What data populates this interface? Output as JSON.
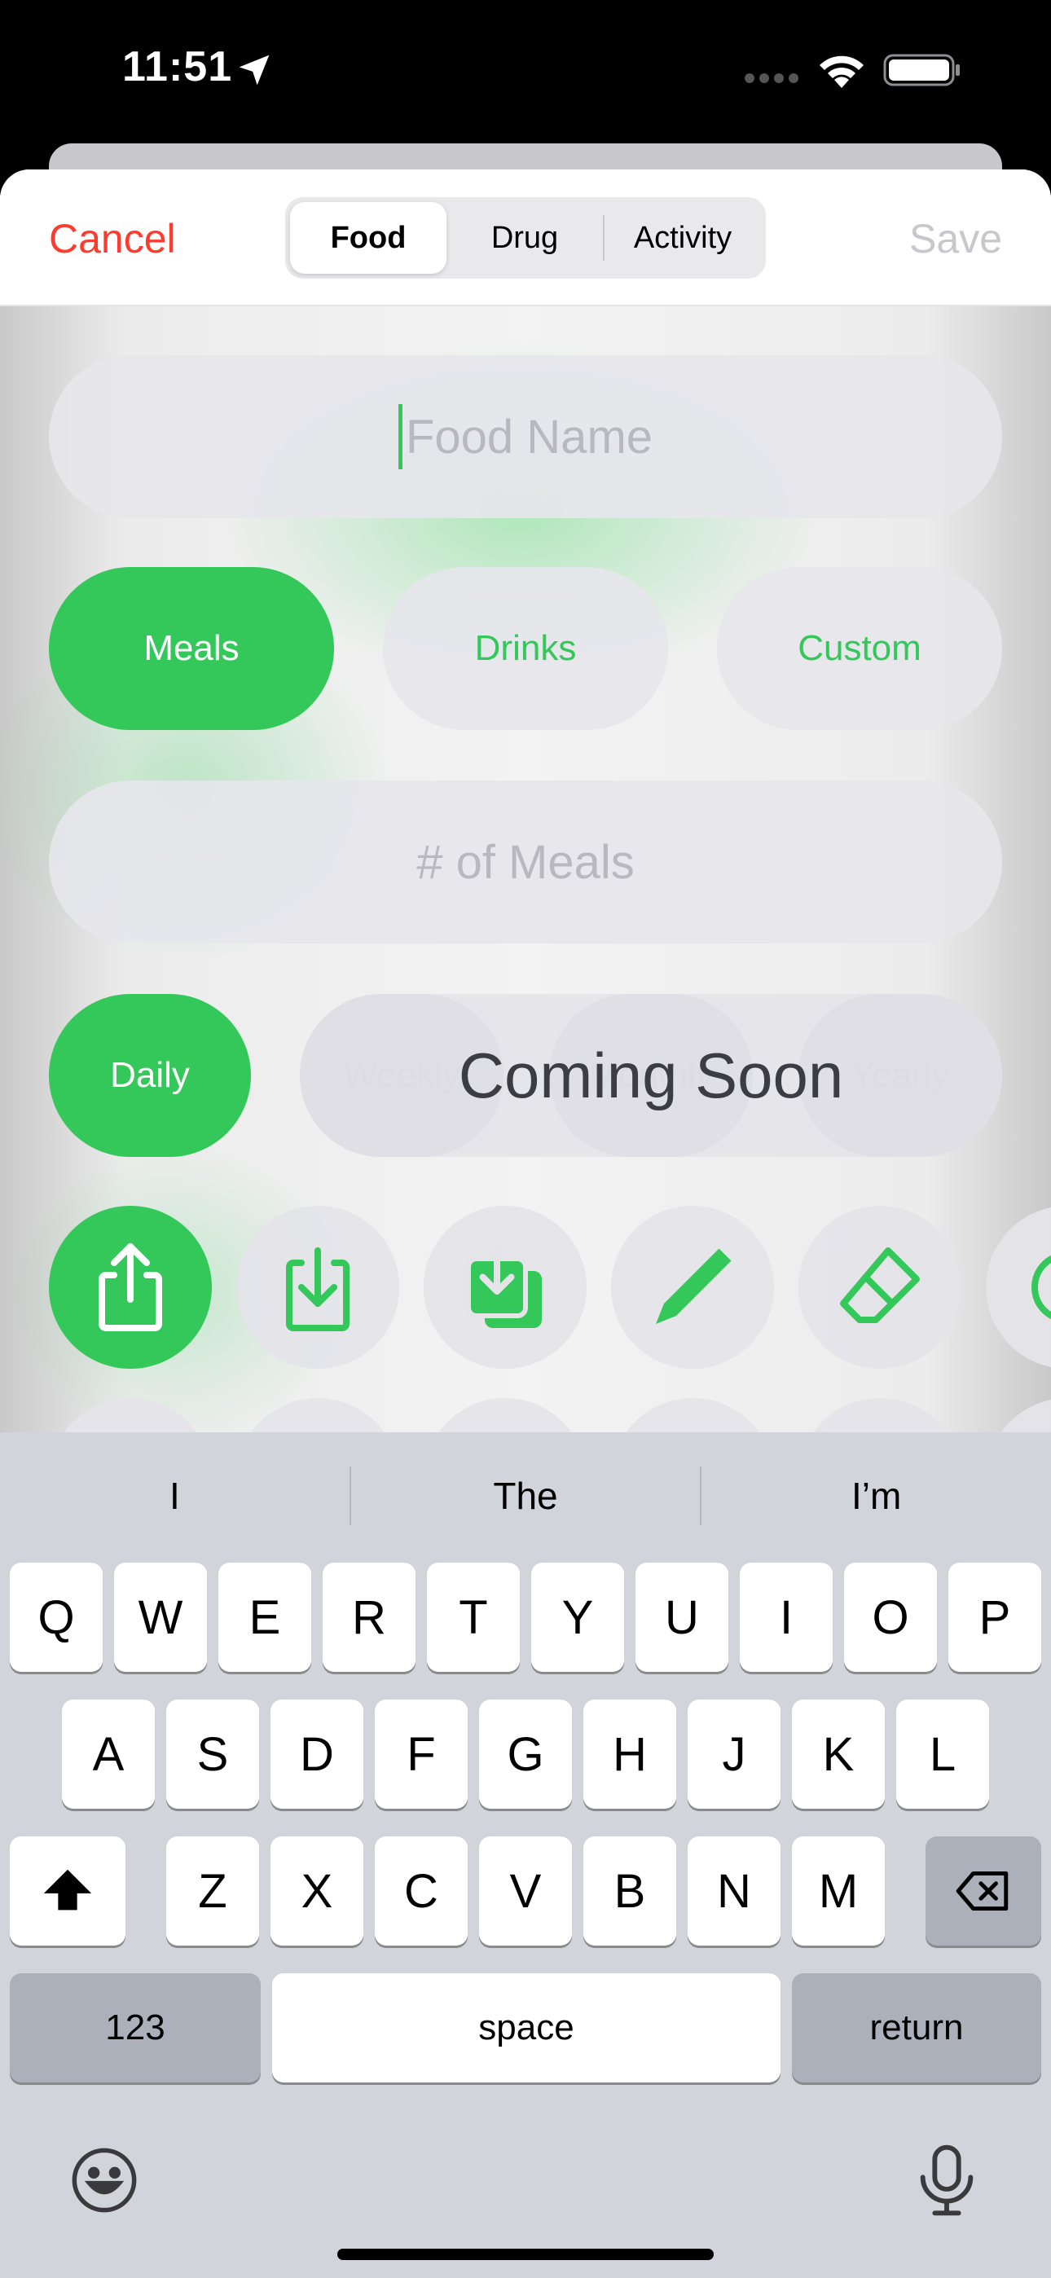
{
  "status": {
    "time": "11:51"
  },
  "nav": {
    "cancel": "Cancel",
    "save": "Save",
    "segments": [
      "Food",
      "Drug",
      "Activity"
    ],
    "active_segment": 0
  },
  "form": {
    "food_name_placeholder": "Food Name",
    "categories": [
      "Meals",
      "Drinks",
      "Custom"
    ],
    "active_category": 0,
    "count_placeholder": "# of Meals",
    "frequency": {
      "daily": "Daily",
      "weekly": "Weekly",
      "monthly": "Monthly",
      "yearly": "Yearly"
    },
    "coming_soon": "Coming Soon"
  },
  "icons": [
    "share-icon",
    "import-icon",
    "import-stack-icon",
    "pencil-icon",
    "eraser-icon",
    "partial-icon"
  ],
  "keyboard": {
    "predictions": [
      "I",
      "The",
      "I’m"
    ],
    "row1": [
      "Q",
      "W",
      "E",
      "R",
      "T",
      "Y",
      "U",
      "I",
      "O",
      "P"
    ],
    "row2": [
      "A",
      "S",
      "D",
      "F",
      "G",
      "H",
      "J",
      "K",
      "L"
    ],
    "row3": [
      "Z",
      "X",
      "C",
      "V",
      "B",
      "N",
      "M"
    ],
    "numbers": "123",
    "space": "space",
    "return": "return"
  },
  "colors": {
    "accent": "#34c759",
    "destructive": "#ff3b30",
    "disabled": "#c7c7cc"
  }
}
